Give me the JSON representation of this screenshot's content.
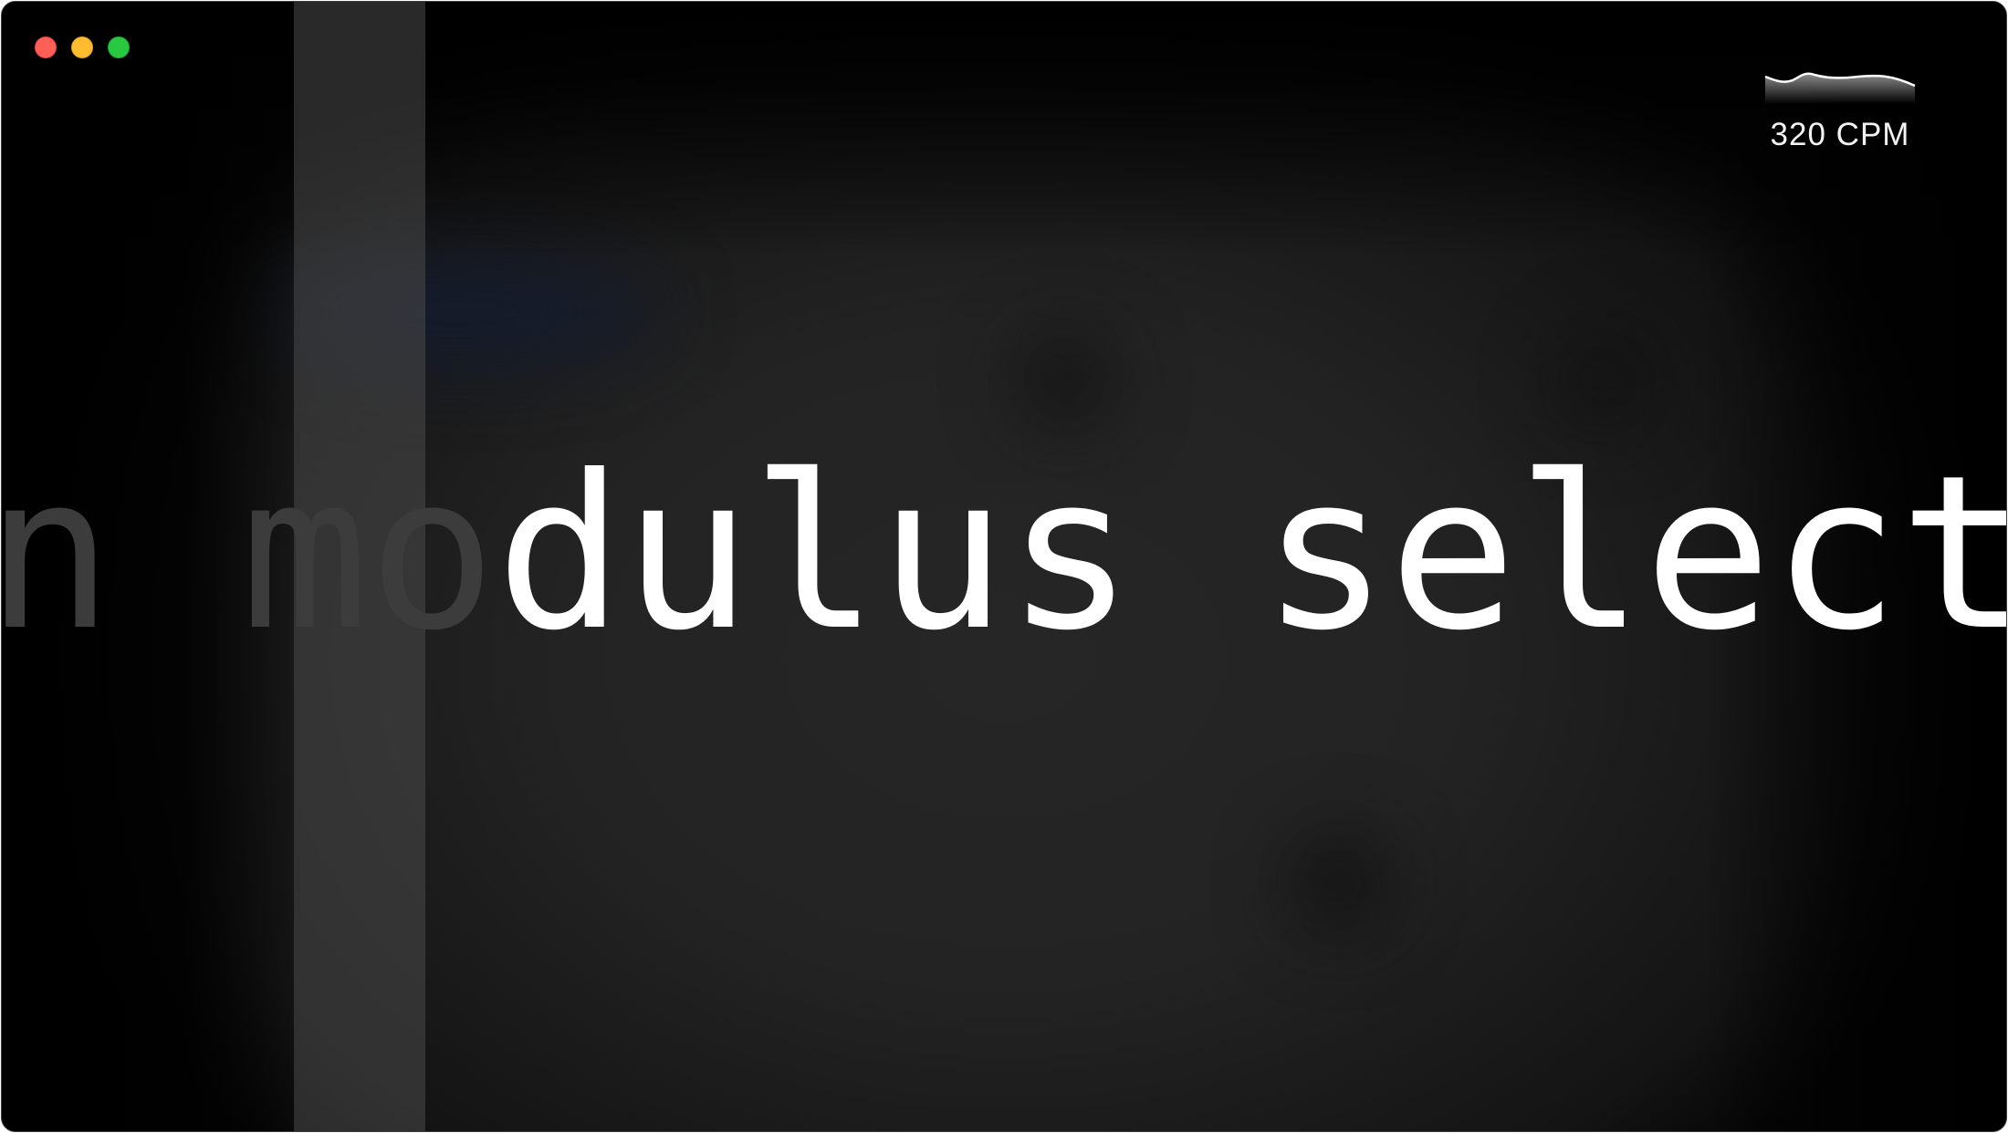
{
  "window": {
    "controls": [
      {
        "name": "close",
        "color": "#fe5f57"
      },
      {
        "name": "minimize",
        "color": "#febc2e"
      },
      {
        "name": "zoom",
        "color": "#28c840"
      }
    ]
  },
  "typing": {
    "typed_text": "n mo",
    "upcoming_text": "dulus select"
  },
  "stats": {
    "speed_label": "320 CPM"
  },
  "colors": {
    "typed": "#3c3c3c",
    "upcoming": "#ffffff",
    "background": "#232323"
  }
}
